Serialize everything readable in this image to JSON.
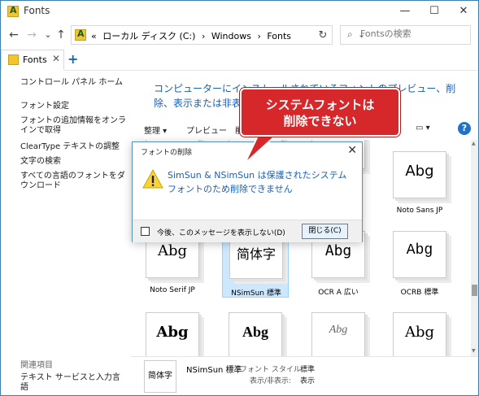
{
  "window": {
    "title": "Fonts",
    "minimize": "—",
    "maximize": "☐",
    "close": "✕"
  },
  "nav": {
    "back": "←",
    "forward": "→",
    "recent": "⌄",
    "up": "↑",
    "refresh": "↻"
  },
  "address": {
    "prefix": "«",
    "crumbs": [
      "ローカル ディスク (C:)",
      "›",
      "Windows",
      "›",
      "Fonts"
    ],
    "dropdown": "⌄"
  },
  "search": {
    "placeholder": "Fontsの検索",
    "icon": "search-icon"
  },
  "tabs": {
    "active_label": "Fonts",
    "close": "✕",
    "add": "+"
  },
  "sidebar": {
    "items": [
      "コントロール パネル ホーム",
      "フォント設定",
      "フォントの追加情報をオンラインで取得",
      "ClearType テキストの調整",
      "文字の検索",
      "すべての言語のフォントをダウンロード"
    ],
    "related_heading": "関連項目",
    "related_items": [
      "テキスト サービスと入力言語"
    ]
  },
  "main": {
    "heading": "コンピューターにインストールされているフォントのプレビュー、削除、表示または非表示にします"
  },
  "toolbar": {
    "organize": "整理 ▾",
    "preview": "プレビュー",
    "delete": "削",
    "view": "▭ ▾",
    "help": "?"
  },
  "fonts": [
    {
      "sample": "",
      "name": ""
    },
    {
      "sample": "",
      "name": ""
    },
    {
      "sample": "",
      "name": ""
    },
    {
      "sample": "Abg",
      "name": "Noto Sans JP"
    },
    {
      "sample": "Abg",
      "name": "Noto Serif JP"
    },
    {
      "sample": "简体字",
      "name": "NSimSun 標準"
    },
    {
      "sample": "Abg",
      "name": "OCR A 広い"
    },
    {
      "sample": "Abg",
      "name": "OCRB 標準"
    },
    {
      "sample": "Abg",
      "name": ""
    },
    {
      "sample": "Abg",
      "name": ""
    },
    {
      "sample": "Abg",
      "name": ""
    },
    {
      "sample": "Abg",
      "name": ""
    }
  ],
  "details": {
    "thumb": "简体字",
    "name": "NSimSun 標準",
    "style_label": "フォント スタイル:",
    "style_value": "標準",
    "visibility_label": "表示/非表示:",
    "visibility_value": "表示"
  },
  "dialog": {
    "title": "フォントの削除",
    "close": "✕",
    "message": "SimSun & NSimSun は保護されたシステムフォントのため削除できません",
    "checkbox_label": "今後、このメッセージを表示しない(D)",
    "button": "閉じる(C)"
  },
  "callout": {
    "line1": "システムフォントは",
    "line2": "削除できない"
  },
  "colors": {
    "accent": "#1a5fb4",
    "callout": "#d6282a",
    "selection": "#cce8ff"
  }
}
